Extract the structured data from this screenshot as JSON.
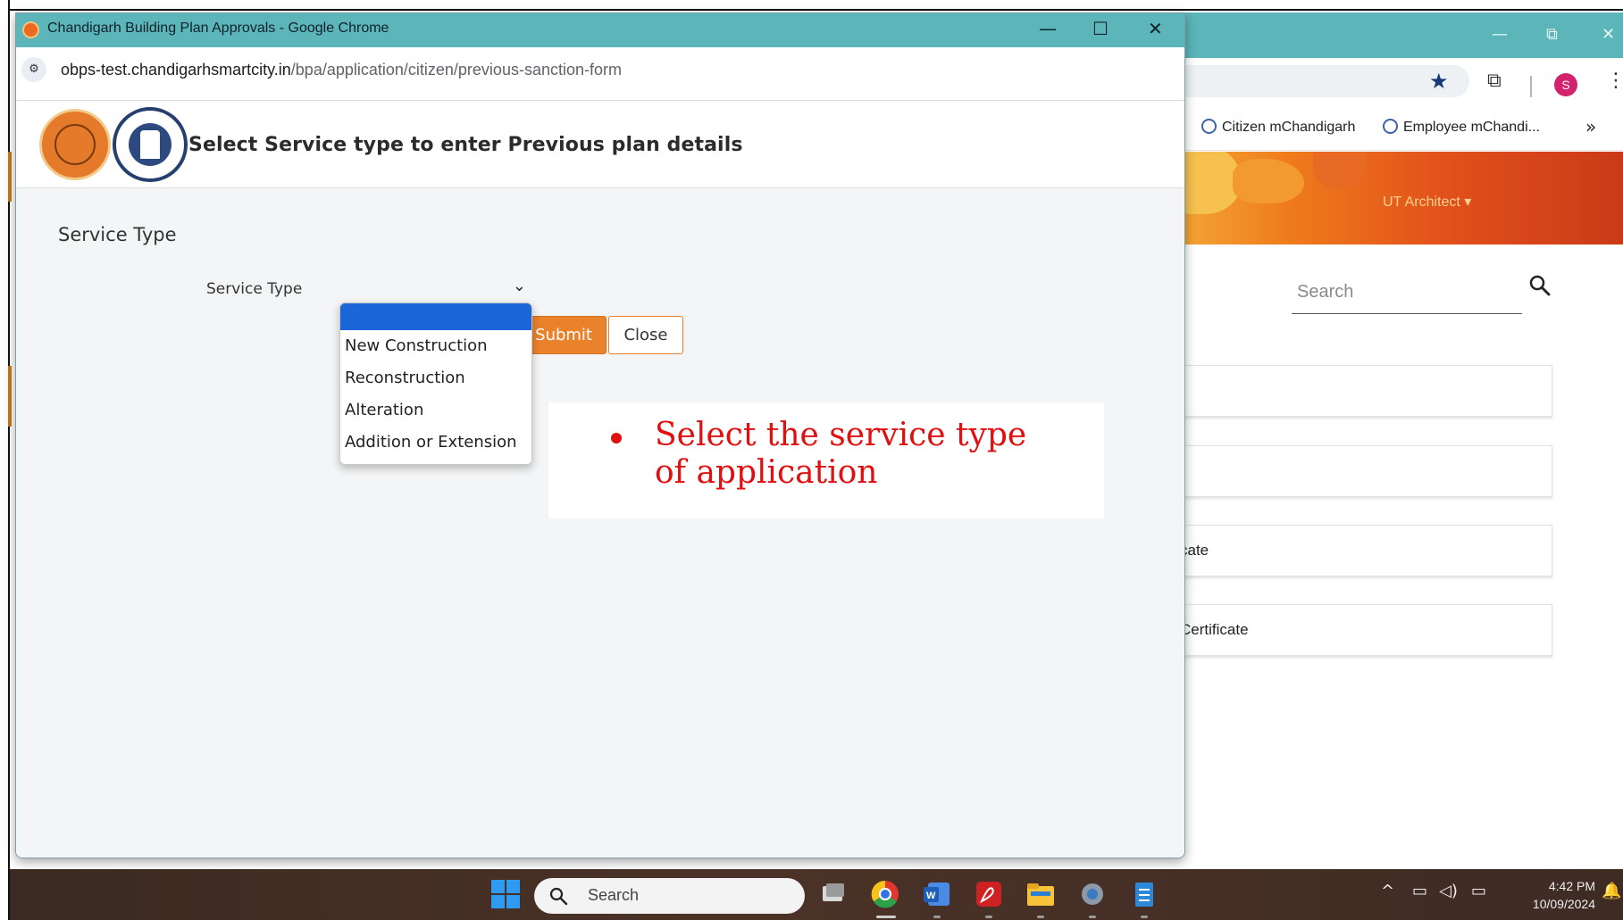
{
  "popup_window": {
    "title": "Chandigarh Building Plan Approvals - Google Chrome",
    "url_domain": "obps-test.chandigarhsmartcity.in",
    "url_path": "/bpa/application/citizen/previous-sanction-form",
    "header_title": "Select Service type to enter Previous plan details",
    "section_title": "Service Type",
    "field_label": "Service Type",
    "select_value": "",
    "dropdown_options": [
      "",
      "New Construction",
      "Reconstruction",
      "Alteration",
      "Addition or Extension"
    ],
    "submit_label": "Submit",
    "close_label": "Close",
    "controls": {
      "minimize": "—",
      "maximize": "☐",
      "close": "✕"
    }
  },
  "callout": {
    "text": "Select the service type of application",
    "color": "#e10f0f"
  },
  "background_window": {
    "bookmarks": [
      "Citizen mChandigarh",
      "Employee mChandi..."
    ],
    "more_bookmarks": "»",
    "profile_initial": "S",
    "user_menu": "UT Architect ▾",
    "search_placeholder": "Search",
    "cards": [
      "",
      "",
      "cate",
      "Certificate"
    ],
    "theme_color": "#5bb5b9"
  },
  "taskbar": {
    "search_placeholder": "Search",
    "time": "4:42 PM",
    "date": "10/09/2024"
  }
}
